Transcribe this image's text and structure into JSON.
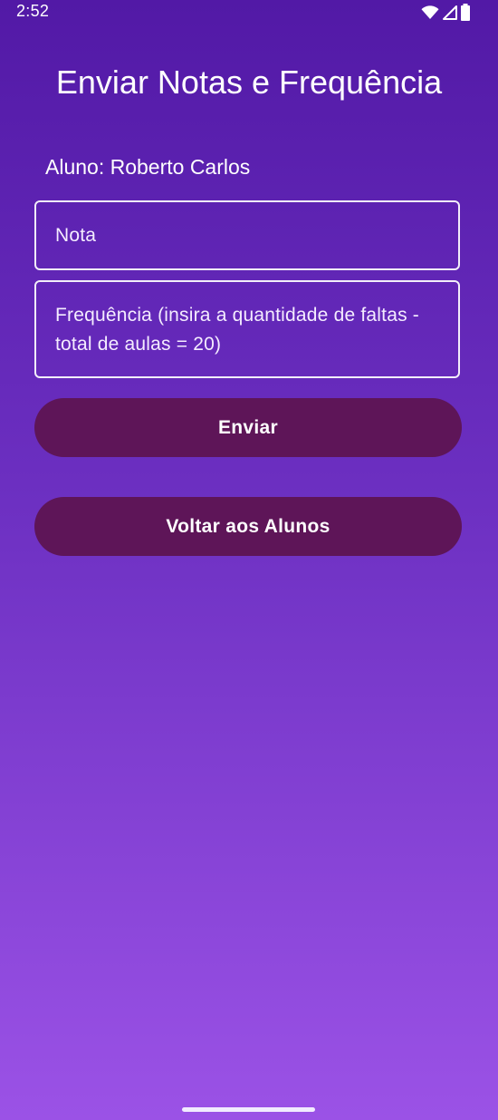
{
  "status_bar": {
    "time": "2:52",
    "icons": [
      "wifi-icon",
      "signal-icon",
      "battery-icon"
    ]
  },
  "page": {
    "title": "Enviar Notas e Frequência",
    "student_label": "Aluno: Roberto Carlos"
  },
  "form": {
    "nota_placeholder": "Nota",
    "frequencia_placeholder": "Frequência (insira a quantidade de faltas - total de aulas = 20)",
    "submit_label": "Enviar",
    "back_label": "Voltar aos Alunos"
  },
  "colors": {
    "background_top": "#5219a6",
    "background_bottom": "#9b52e6",
    "button": "#5e1558",
    "text": "#ffffff"
  }
}
